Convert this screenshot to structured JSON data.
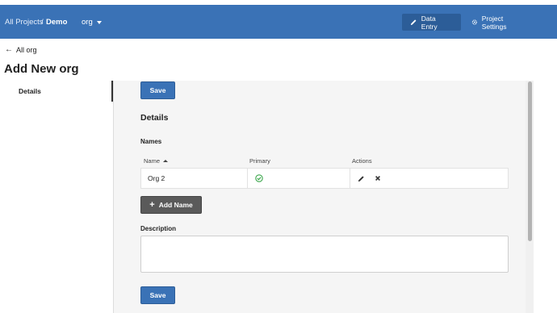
{
  "header": {
    "breadcrumb_all": "All Projects",
    "breadcrumb_sep": "/",
    "breadcrumb_project": "Demo",
    "org_select": "org",
    "data_entry": "Data Entry",
    "project_settings": "Project Settings"
  },
  "back_link": "All org",
  "page_title": "Add New org",
  "sidebar": {
    "items": [
      {
        "label": "Details"
      }
    ]
  },
  "form": {
    "save_label": "Save",
    "section_title": "Details",
    "names_label": "Names",
    "columns": [
      "Name",
      "Primary",
      "Actions"
    ],
    "rows": [
      {
        "name": "Org 2",
        "primary": true
      }
    ],
    "add_name_label": "Add Name",
    "description_label": "Description",
    "description_value": ""
  },
  "colors": {
    "header_bg": "#3a72b6",
    "primary_button": "#3a72b6",
    "check_green": "#3aa64a"
  },
  "icons": [
    "back-arrow-icon",
    "pencil-icon",
    "gear-icon",
    "caret-down-icon",
    "sort-up-icon",
    "check-circle-icon",
    "edit-icon",
    "delete-icon",
    "plus-icon"
  ]
}
